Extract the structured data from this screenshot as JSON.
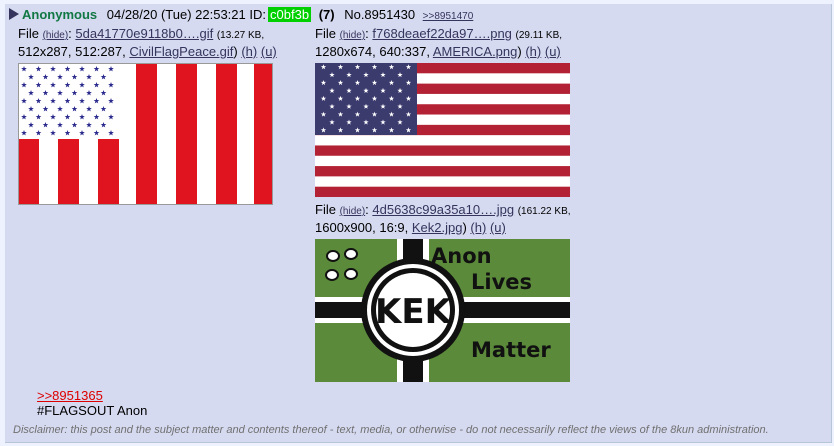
{
  "post": {
    "name": "Anonymous",
    "date": "04/28/20 (Tue) 22:53:21",
    "id_label": "ID:",
    "id_value": "c0bf3b",
    "id_color": "#00d000",
    "reply_count": "(7)",
    "post_number": "No.8951430",
    "backlink": ">>8951470"
  },
  "files": [
    {
      "label": "File",
      "hide": "(hide)",
      "filename": "5da41770e9118b0….gif",
      "size": "(13.27 KB,",
      "meta": "512x287, 512:287,",
      "original_name": "CivilFlagPeace.gif",
      "h": "(h)",
      "u": "(u)"
    },
    {
      "label": "File",
      "hide": "(hide)",
      "filename": "f768deaef22da97….png",
      "size": "(29.11 KB,",
      "meta": "1280x674, 640:337,",
      "original_name": "AMERICA.png",
      "h": "(h)",
      "u": "(u)"
    },
    {
      "label": "File",
      "hide": "(hide)",
      "filename": "4d5638c99a35a10….jpg",
      "size": "(161.22 KB,",
      "meta": "1600x900, 16:9,",
      "original_name": "Kek2.jpg",
      "h": "(h)",
      "u": "(u)"
    }
  ],
  "kek_flag": {
    "line1": "Anon",
    "line2": "Lives",
    "line3": "Matter",
    "emblem": "KEK"
  },
  "body": {
    "quote_link": ">>8951365",
    "text": "#FLAGSOUT Anon"
  },
  "disclaimer": "Disclaimer: this post and the subject matter and contents thereof - text, media, or otherwise - do not necessarily reflect the views of the 8kun administration."
}
